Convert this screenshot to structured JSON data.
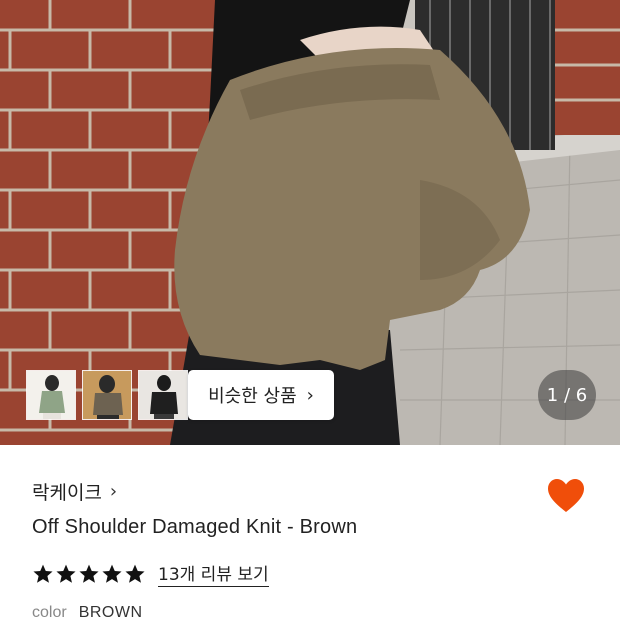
{
  "gallery": {
    "similar_button_label": "비슷한 상품",
    "similar_button_chevron": "›",
    "counter": "1 / 6",
    "current_image": 1,
    "total_images": 6,
    "thumbnail_icons": [
      "thumbnail-1",
      "thumbnail-2",
      "thumbnail-3"
    ]
  },
  "product": {
    "brand": "락케이크",
    "brand_chevron": "›",
    "name": "Off Shoulder Damaged Knit - Brown",
    "rating_stars": 5,
    "review_link": "13개 리뷰 보기",
    "option_label": "color",
    "option_value": "BROWN",
    "wishlisted": true
  },
  "colors": {
    "heart": "#f04e0a",
    "star": "#111111",
    "sweater": "#8a7a5e",
    "brick": "#a0452f"
  },
  "icons": {
    "heart": "heart-icon",
    "star": "star-icon",
    "chevron": "chevron-right-icon"
  }
}
